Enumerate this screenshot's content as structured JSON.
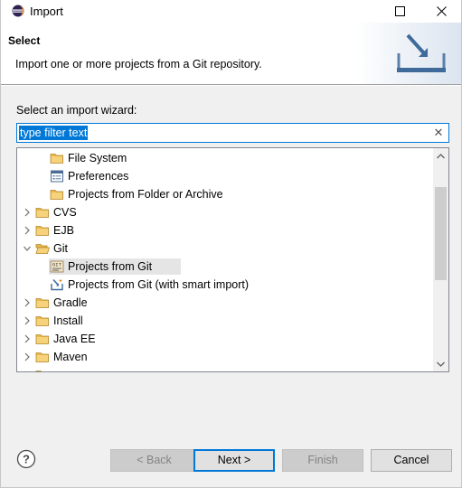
{
  "window": {
    "title": "Import",
    "icon": "eclipse-icon"
  },
  "banner": {
    "title": "Select",
    "description": "Import one or more projects from a Git repository.",
    "graphic": "import-wizard-banner-icon"
  },
  "wizard": {
    "label": "Select an import wizard:",
    "filter": {
      "value": "type filter text",
      "clear_icon": "clear-icon",
      "clear_glyph": "✕"
    }
  },
  "tree": {
    "items": [
      {
        "label": "File System",
        "icon": "folder-icon",
        "level": 2,
        "expander": "none"
      },
      {
        "label": "Preferences",
        "icon": "preferences-icon",
        "level": 2,
        "expander": "none"
      },
      {
        "label": "Projects from Folder or Archive",
        "icon": "folder-icon",
        "level": 2,
        "expander": "none"
      },
      {
        "label": "CVS",
        "icon": "folder-icon",
        "level": 1,
        "expander": "collapsed"
      },
      {
        "label": "EJB",
        "icon": "folder-icon",
        "level": 1,
        "expander": "collapsed"
      },
      {
        "label": "Git",
        "icon": "folder-open-icon",
        "level": 1,
        "expander": "expanded"
      },
      {
        "label": "Projects from Git",
        "icon": "git-project-icon",
        "level": 2,
        "expander": "none",
        "highlighted": true
      },
      {
        "label": "Projects from Git (with smart import)",
        "icon": "smart-import-icon",
        "level": 2,
        "expander": "none"
      },
      {
        "label": "Gradle",
        "icon": "folder-icon",
        "level": 1,
        "expander": "collapsed"
      },
      {
        "label": "Install",
        "icon": "folder-icon",
        "level": 1,
        "expander": "collapsed"
      },
      {
        "label": "Java EE",
        "icon": "folder-icon",
        "level": 1,
        "expander": "collapsed"
      },
      {
        "label": "Maven",
        "icon": "folder-icon",
        "level": 1,
        "expander": "collapsed"
      },
      {
        "label": "",
        "icon": "folder-icon",
        "level": 1,
        "expander": "collapsed"
      }
    ]
  },
  "buttons": {
    "help_icon": "help-icon",
    "back": "< Back",
    "next": "Next >",
    "finish": "Finish",
    "cancel": "Cancel"
  },
  "colors": {
    "accent": "#0078d7",
    "folder": "#e8b84a",
    "button_face": "#e1e1e1",
    "disabled_text": "#838383"
  }
}
